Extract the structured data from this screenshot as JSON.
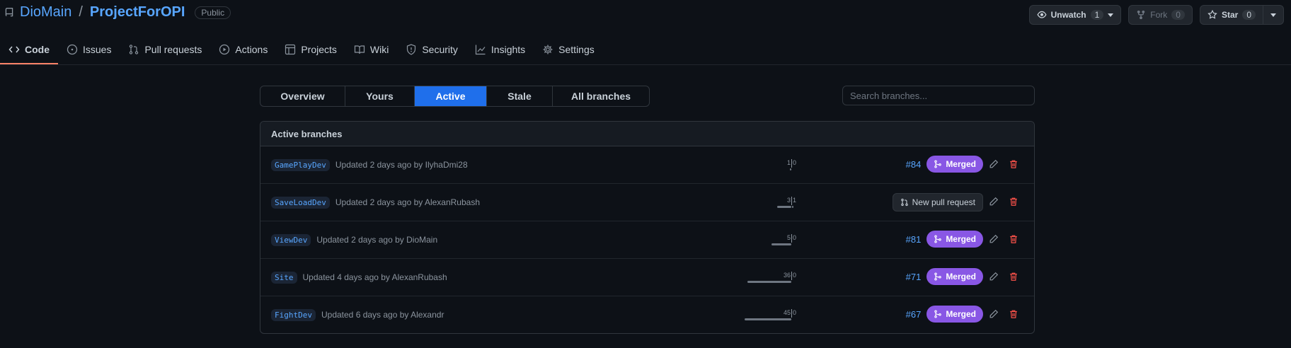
{
  "repo": {
    "owner": "DioMain",
    "separator": "/",
    "name": "ProjectForOPI",
    "visibility": "Public"
  },
  "header_actions": {
    "unwatch_label": "Unwatch",
    "unwatch_count": "1",
    "fork_label": "Fork",
    "fork_count": "0",
    "star_label": "Star",
    "star_count": "0"
  },
  "tabs": [
    {
      "label": "Code",
      "icon": "code-icon"
    },
    {
      "label": "Issues",
      "icon": "issue-opened-icon"
    },
    {
      "label": "Pull requests",
      "icon": "git-pull-request-icon"
    },
    {
      "label": "Actions",
      "icon": "play-icon"
    },
    {
      "label": "Projects",
      "icon": "table-icon"
    },
    {
      "label": "Wiki",
      "icon": "book-icon"
    },
    {
      "label": "Security",
      "icon": "shield-icon"
    },
    {
      "label": "Insights",
      "icon": "graph-icon"
    },
    {
      "label": "Settings",
      "icon": "gear-icon"
    }
  ],
  "branch_filters": [
    "Overview",
    "Yours",
    "Active",
    "Stale",
    "All branches"
  ],
  "active_filter": "Active",
  "search": {
    "placeholder": "Search branches..."
  },
  "branches_box": {
    "title": "Active branches"
  },
  "branches": [
    {
      "name": "GamePlayDev",
      "updated": "Updated 2 days ago by IlyhaDmi28",
      "behind": "1",
      "ahead": "0",
      "pr_number": "#84",
      "pr_status": "Merged"
    },
    {
      "name": "SaveLoadDev",
      "updated": "Updated 2 days ago by AlexanRubash",
      "behind": "3",
      "ahead": "1",
      "pr_action": "New pull request"
    },
    {
      "name": "ViewDev",
      "updated": "Updated 2 days ago by DioMain",
      "behind": "5",
      "ahead": "0",
      "pr_number": "#81",
      "pr_status": "Merged"
    },
    {
      "name": "Site",
      "updated": "Updated 4 days ago by AlexanRubash",
      "behind": "36",
      "ahead": "0",
      "pr_number": "#71",
      "pr_status": "Merged"
    },
    {
      "name": "FightDev",
      "updated": "Updated 6 days ago by Alexandr",
      "behind": "45",
      "ahead": "0",
      "pr_number": "#67",
      "pr_status": "Merged"
    }
  ],
  "colors": {
    "background": "#0d1117",
    "link": "#58a6ff",
    "active_tab_underline": "#f78166",
    "active_filter": "#1f6feb",
    "merged": "#8957e5",
    "delete": "#f85149"
  }
}
